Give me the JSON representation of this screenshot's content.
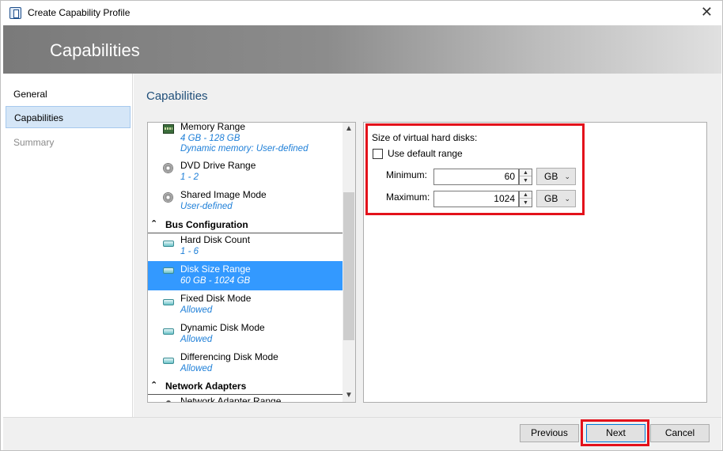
{
  "window": {
    "title": "Create Capability Profile",
    "close_glyph": "✕"
  },
  "banner": {
    "title": "Capabilities"
  },
  "nav": {
    "items": [
      {
        "label": "General",
        "state": "normal"
      },
      {
        "label": "Capabilities",
        "state": "active"
      },
      {
        "label": "Summary",
        "state": "disabled"
      }
    ]
  },
  "content": {
    "title": "Capabilities"
  },
  "capability_list": {
    "items": [
      {
        "name": "Memory Range",
        "value": "4 GB - 128 GB",
        "value2": "Dynamic memory: User-defined",
        "icon": "memory-chip-icon"
      },
      {
        "name": "DVD Drive Range",
        "value": "1 - 2",
        "icon": "dvd-disc-icon"
      },
      {
        "name": "Shared Image Mode",
        "value": "User-defined",
        "icon": "disc-icon"
      },
      {
        "group": "Bus Configuration",
        "icon": "collapse-chevron-icon"
      },
      {
        "name": "Hard Disk Count",
        "value": "1 - 6",
        "icon": "hard-disk-icon"
      },
      {
        "name": "Disk Size Range",
        "value": "60 GB - 1024 GB",
        "icon": "hard-disk-icon",
        "selected": true
      },
      {
        "name": "Fixed Disk Mode",
        "value": "Allowed",
        "icon": "hard-disk-icon"
      },
      {
        "name": "Dynamic Disk Mode",
        "value": "Allowed",
        "icon": "hard-disk-icon"
      },
      {
        "name": "Differencing Disk Mode",
        "value": "Allowed",
        "icon": "hard-disk-icon"
      },
      {
        "group": "Network Adapters",
        "icon": "collapse-chevron-icon"
      },
      {
        "name": "Network Adapter Range",
        "icon": "network-adapter-icon"
      }
    ],
    "chevron_glyph": "⌃",
    "scroll_up_glyph": "▲",
    "scroll_down_glyph": "▼"
  },
  "detail": {
    "section_label": "Size of virtual hard disks:",
    "use_default_range": {
      "label": "Use default range",
      "checked": false
    },
    "minimum": {
      "label": "Minimum:",
      "value": "60",
      "unit": "GB"
    },
    "maximum": {
      "label": "Maximum:",
      "value": "1024",
      "unit": "GB"
    },
    "spin_up_glyph": "▲",
    "spin_down_glyph": "▼",
    "dropdown_glyph": "⌄"
  },
  "footer": {
    "previous_label": "Previous",
    "next_label": "Next",
    "cancel_label": "Cancel"
  },
  "colors": {
    "highlight": "#e3111b",
    "selection": "#3399ff",
    "value_text": "#1e7fd8",
    "title_text": "#1f4e79"
  }
}
